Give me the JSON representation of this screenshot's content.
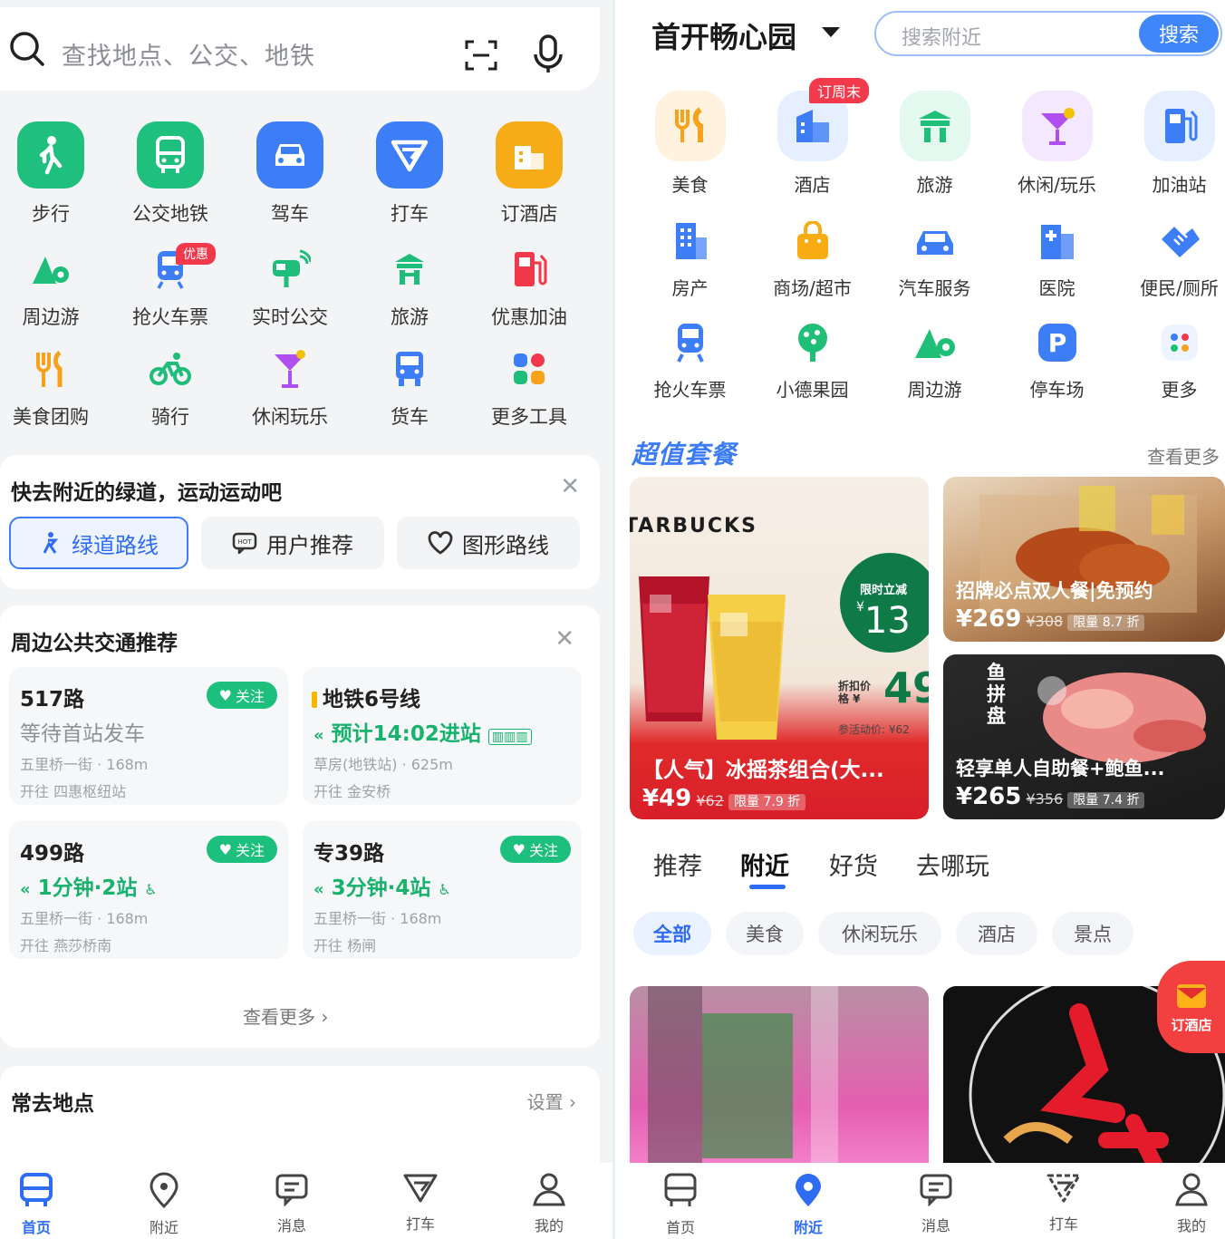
{
  "left": {
    "search": {
      "placeholder": "查找地点、公交、地铁"
    },
    "main_modes": [
      {
        "label": "步行",
        "icon": "walk-icon",
        "color": "#1fc07e"
      },
      {
        "label": "公交地铁",
        "icon": "bus-icon",
        "color": "#1fc07e"
      },
      {
        "label": "驾车",
        "icon": "car-icon",
        "color": "#3d7ef6"
      },
      {
        "label": "打车",
        "icon": "taxi-icon",
        "color": "#3d7ef6"
      },
      {
        "label": "订酒店",
        "icon": "hotel-icon",
        "color": "#f6ac17"
      }
    ],
    "tools_row1": [
      {
        "label": "周边游",
        "icon": "nearby-trip-icon"
      },
      {
        "label": "抢火车票",
        "icon": "train-icon",
        "badge": "优惠"
      },
      {
        "label": "实时公交",
        "icon": "realtime-bus-icon"
      },
      {
        "label": "旅游",
        "icon": "travel-icon"
      },
      {
        "label": "优惠加油",
        "icon": "fuel-icon"
      }
    ],
    "tools_row2": [
      {
        "label": "美食团购",
        "icon": "food-icon"
      },
      {
        "label": "骑行",
        "icon": "bike-icon"
      },
      {
        "label": "休闲玩乐",
        "icon": "cocktail-icon"
      },
      {
        "label": "货车",
        "icon": "truck-icon"
      },
      {
        "label": "更多工具",
        "icon": "more-tools-icon"
      }
    ],
    "greenway": {
      "title": "快去附近的绿道，运动运动吧",
      "buttons": [
        "绿道路线",
        "用户推荐",
        "图形路线"
      ]
    },
    "transit": {
      "title": "周边公共交通推荐",
      "cards": [
        {
          "name": "517路",
          "status": "等待首站发车",
          "stop": "五里桥一街 · 168m",
          "dir": "开往 四惠枢纽站",
          "follow": "关注"
        },
        {
          "name": "地铁6号线",
          "status": "预计14:02进站",
          "stop": "草房(地铁站) · 625m",
          "dir": "开往 金安桥"
        },
        {
          "name": "499路",
          "status": "1分钟·2站",
          "stop": "五里桥一街 · 168m",
          "dir": "开往 燕莎桥南",
          "follow": "关注"
        },
        {
          "name": "专39路",
          "status": "3分钟·4站",
          "stop": "五里桥一街 · 168m",
          "dir": "开往 杨闸",
          "follow": "关注"
        }
      ],
      "more": "查看更多"
    },
    "frequent": {
      "title": "常去地点",
      "settings": "设置"
    },
    "tabbar": [
      {
        "label": "首页",
        "icon": "home-bus-icon",
        "active": true
      },
      {
        "label": "附近",
        "icon": "location-pin-icon"
      },
      {
        "label": "消息",
        "icon": "message-icon"
      },
      {
        "label": "打车",
        "icon": "taxi-icon"
      },
      {
        "label": "我的",
        "icon": "profile-icon"
      }
    ]
  },
  "right": {
    "location": "首开畅心园",
    "search": {
      "placeholder": "搜索附近",
      "button": "搜索"
    },
    "cat_row1": [
      {
        "label": "美食",
        "icon": "food-icon",
        "color": "#f7a21a"
      },
      {
        "label": "酒店",
        "icon": "hotel-icon",
        "color": "#3d7ef6",
        "badge": "订周末"
      },
      {
        "label": "旅游",
        "icon": "travel-icon",
        "color": "#1fbf78"
      },
      {
        "label": "休闲/玩乐",
        "icon": "cocktail-icon",
        "color": "#b04ef0"
      },
      {
        "label": "加油站",
        "icon": "fuel-icon",
        "color": "#3d7ef6"
      }
    ],
    "cat_row2": [
      {
        "label": "房产",
        "icon": "building-icon",
        "color": "#3d7ef6"
      },
      {
        "label": "商场/超市",
        "icon": "shopping-bag-icon",
        "color": "#f7ac14"
      },
      {
        "label": "汽车服务",
        "icon": "car-icon",
        "color": "#3d7ef6"
      },
      {
        "label": "医院",
        "icon": "hospital-icon",
        "color": "#3d7ef6"
      },
      {
        "label": "便民/厕所",
        "icon": "handshake-icon",
        "color": "#3d7ef6"
      }
    ],
    "cat_row3": [
      {
        "label": "抢火车票",
        "icon": "train-icon",
        "color": "#3d7ef6"
      },
      {
        "label": "小德果园",
        "icon": "tree-icon",
        "color": "#1fbf78"
      },
      {
        "label": "周边游",
        "icon": "nearby-trip-icon",
        "color": "#1fbf78"
      },
      {
        "label": "停车场",
        "icon": "parking-icon",
        "color": "#3d7ef6"
      },
      {
        "label": "更多",
        "icon": "more-icon",
        "color": "#3d7ef6"
      }
    ],
    "deals": {
      "title": "超值套餐",
      "more": "查看更多",
      "starbucks": {
        "brand": "TARBUCKS",
        "caption": "【人气】冰摇茶组合(大...",
        "price": "¥49",
        "old": "¥62",
        "limit": "限量 7.9 折",
        "badge_label": "限时立减",
        "badge_value": "13",
        "discount_label": "折扣价格 ¥",
        "discount_value": "49",
        "activity": "参活动价: ¥62"
      },
      "chicken": {
        "caption": "招牌必点双人餐|免预约",
        "price": "¥269",
        "old": "¥308",
        "limit": "限量 8.7 折"
      },
      "sashimi": {
        "caption": "轻享单人自助餐+鲍鱼...",
        "price": "¥265",
        "old": "¥356",
        "limit": "限量 7.4 折",
        "vertical": "鱼拼盘"
      }
    },
    "feed_tabs": [
      "推荐",
      "附近",
      "好货",
      "去哪玩"
    ],
    "chips": [
      "全部",
      "美食",
      "休闲玩乐",
      "酒店",
      "景点"
    ],
    "float_hotel": "订酒店",
    "tabbar": [
      {
        "label": "首页",
        "icon": "home-icon"
      },
      {
        "label": "附近",
        "icon": "location-pin-icon",
        "active": true
      },
      {
        "label": "消息",
        "icon": "message-icon"
      },
      {
        "label": "打车",
        "icon": "taxi-icon"
      },
      {
        "label": "我的",
        "icon": "profile-icon"
      }
    ]
  }
}
